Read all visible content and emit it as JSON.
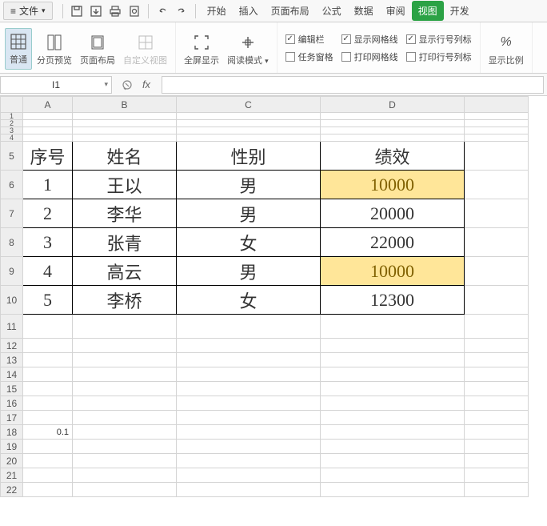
{
  "menubar": {
    "file_label": "文件",
    "tabs": [
      "开始",
      "插入",
      "页面布局",
      "公式",
      "数据",
      "审阅",
      "视图",
      "开发"
    ],
    "active_tab": "视图"
  },
  "ribbon": {
    "view_modes": {
      "normal": "普通",
      "page_break": "分页预览",
      "page_layout": "页面布局",
      "custom": "自定义视图"
    },
    "fullscreen": "全屏显示",
    "reading_mode": "阅读模式",
    "checks_left": {
      "formula_bar": "编辑栏",
      "task_pane": "任务窗格"
    },
    "checks_mid": {
      "show_grid": "显示网格线",
      "print_grid": "打印网格线"
    },
    "checks_right": {
      "show_headings": "显示行号列标",
      "print_headings": "打印行号列标"
    },
    "zoom": "显示比例"
  },
  "formula": {
    "active_cell": "I1",
    "fx_label": "fx",
    "value": ""
  },
  "sheet": {
    "columns": [
      "A",
      "B",
      "C",
      "D"
    ],
    "small_rows": [
      "1",
      "2",
      "3",
      "4"
    ],
    "headers": {
      "row": "5",
      "a": "序号",
      "b": "姓名",
      "c": "性别",
      "d": "绩效"
    },
    "data": [
      {
        "row": "6",
        "a": "1",
        "b": "王以",
        "c": "男",
        "d": "10000",
        "hl": true
      },
      {
        "row": "7",
        "a": "2",
        "b": "李华",
        "c": "男",
        "d": "20000",
        "hl": false
      },
      {
        "row": "8",
        "a": "3",
        "b": "张青",
        "c": "女",
        "d": "22000",
        "hl": false
      },
      {
        "row": "9",
        "a": "4",
        "b": "高云",
        "c": "男",
        "d": "10000",
        "hl": true
      },
      {
        "row": "10",
        "a": "5",
        "b": "李桥",
        "c": "女",
        "d": "12300",
        "hl": false
      }
    ],
    "empty_rows": [
      "11",
      "12",
      "13",
      "14",
      "15",
      "16",
      "17"
    ],
    "row18": {
      "row": "18",
      "a": "0.1"
    },
    "tail_rows": [
      "19",
      "20",
      "21",
      "22"
    ]
  }
}
